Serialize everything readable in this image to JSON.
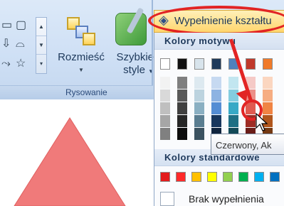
{
  "ribbon": {
    "group_label": "Rysowanie",
    "arrange_label": "Rozmieść",
    "quick_styles_line1": "Szybkie",
    "quick_styles_line2": "style"
  },
  "fill_button": {
    "label": "Wypełnienie kształtu"
  },
  "panel": {
    "theme_colors_label": "Kolory motywu",
    "standard_colors_label": "Kolory standardowe",
    "no_fill_label": "Brak wypełnienia",
    "theme_top_row": [
      "#ffffff",
      "#111111",
      "#d8e4ec",
      "#1f3a5a",
      "#4f81bd",
      "#c0392b",
      "#f07a2a"
    ],
    "theme_columns": [
      [
        "#f2f2f2",
        "#d9d9d9",
        "#bfbfbf",
        "#a6a6a6",
        "#808080"
      ],
      [
        "#7f7f7f",
        "#595959",
        "#404040",
        "#262626",
        "#0d0d0d"
      ],
      [
        "#dde9f0",
        "#bcd3df",
        "#8aafc2",
        "#5a7d90",
        "#3b5260"
      ],
      [
        "#c6d9f1",
        "#8db3e2",
        "#548dd4",
        "#17365d",
        "#0f243e"
      ],
      [
        "#c2e6f0",
        "#84cde0",
        "#37a9c6",
        "#1e6f84",
        "#134a58"
      ],
      [
        "#f5c9c6",
        "#ec8f88",
        "#e05a50",
        "#9e2c24",
        "#6a1d18"
      ],
      [
        "#fbd6c0",
        "#f6ad82",
        "#f08444",
        "#b0561d",
        "#743913"
      ]
    ],
    "standard_colors": [
      "#e31c1c",
      "#ff2a2a",
      "#ffc000",
      "#ffff00",
      "#92d050",
      "#00b050",
      "#00b0f0",
      "#0070c0"
    ]
  },
  "tooltip": {
    "text": "Czerwony, Ak"
  },
  "canvas": {
    "shape_color": "#f07a7a"
  },
  "colors": {
    "highlight_red": "#e22424"
  }
}
